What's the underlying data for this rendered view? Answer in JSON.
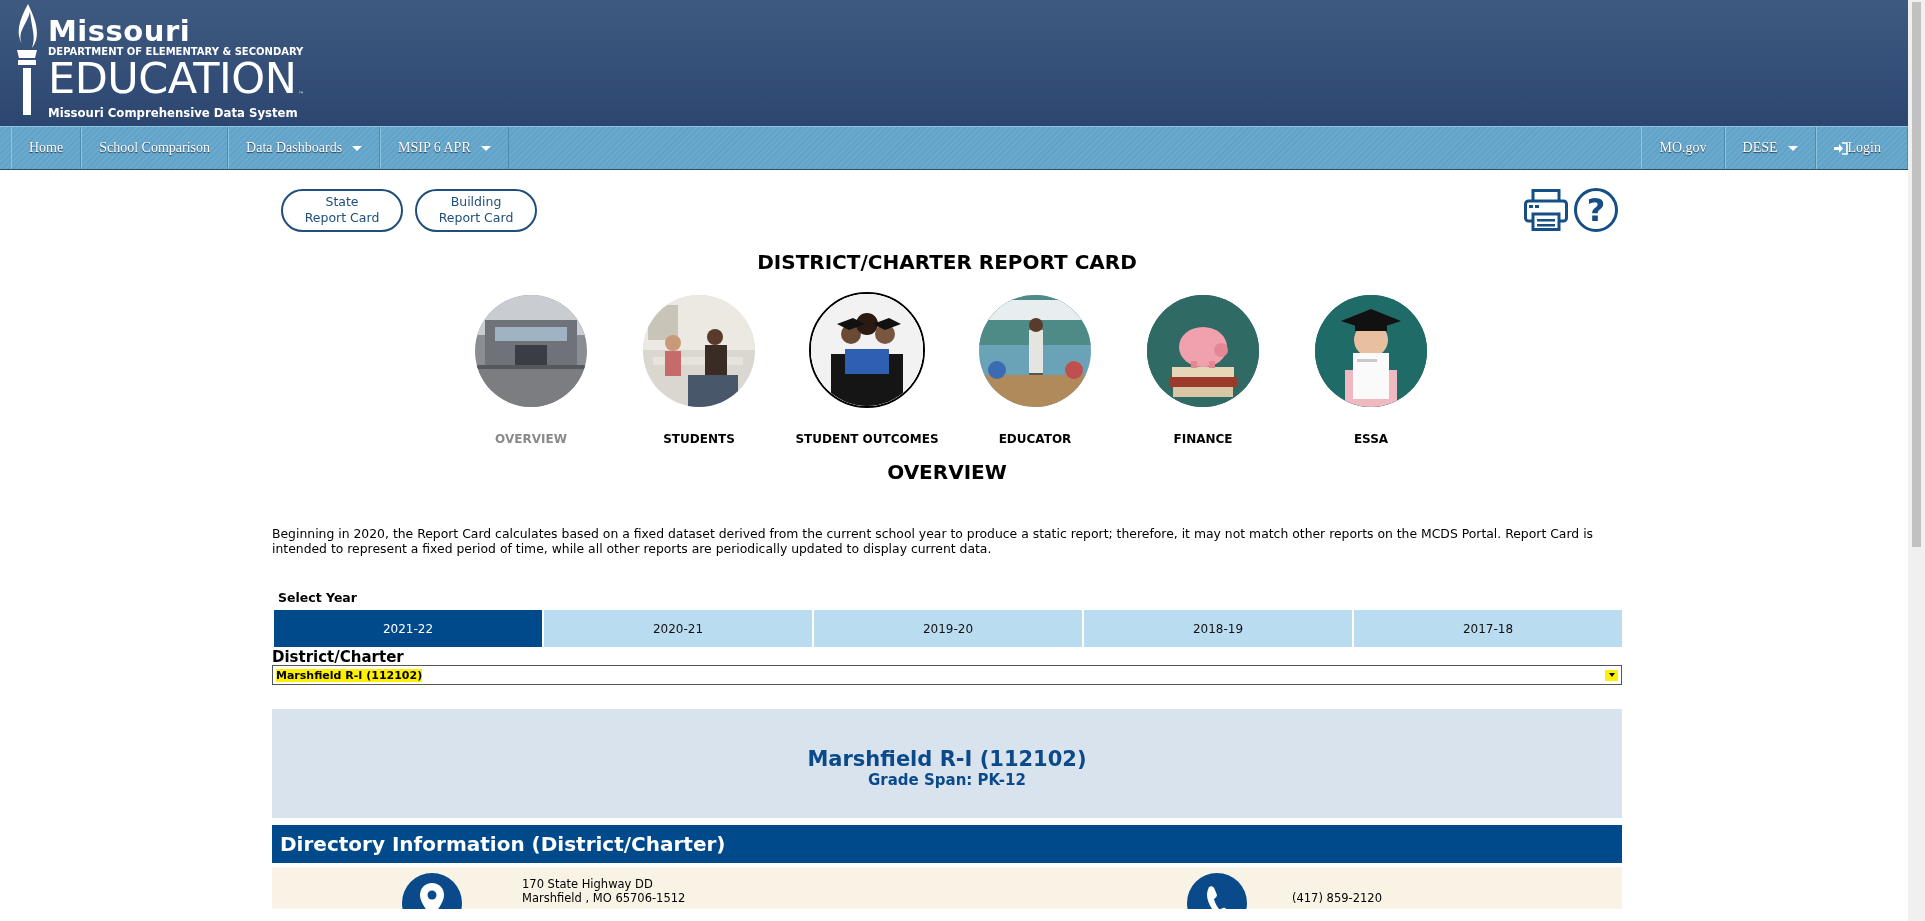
{
  "header": {
    "logo": {
      "title": "Missouri",
      "subtitle": "DEPARTMENT OF ELEMENTARY & SECONDARY",
      "name": "EDUCATION",
      "trademark": "™",
      "tagline": "Missouri Comprehensive Data System"
    }
  },
  "nav": {
    "left": [
      {
        "label": "Home",
        "kind": "link"
      },
      {
        "label": "School Comparison",
        "kind": "link"
      },
      {
        "label": "Data Dashboards",
        "kind": "dropdown"
      },
      {
        "label": "MSIP 6 APR",
        "kind": "dropdown"
      }
    ],
    "right": [
      {
        "label": "MO.gov",
        "kind": "link"
      },
      {
        "label": "DESE",
        "kind": "dropdown"
      },
      {
        "label": "Login",
        "kind": "login"
      }
    ]
  },
  "report_links": [
    {
      "lines": [
        "State",
        "Report Card"
      ]
    },
    {
      "lines": [
        "Building",
        "Report Card"
      ]
    }
  ],
  "tools": {
    "help_symbol": "?"
  },
  "title": "DISTRICT/CHARTER REPORT CARD",
  "categories": [
    {
      "label": "OVERVIEW",
      "selected": true,
      "outlined": false
    },
    {
      "label": "STUDENTS",
      "selected": false,
      "outlined": false
    },
    {
      "label": "STUDENT OUTCOMES",
      "selected": false,
      "outlined": true
    },
    {
      "label": "EDUCATOR",
      "selected": false,
      "outlined": false
    },
    {
      "label": "FINANCE",
      "selected": false,
      "outlined": false
    },
    {
      "label": "ESSA",
      "selected": false,
      "outlined": false
    }
  ],
  "section_title": "OVERVIEW",
  "notice": "Beginning in 2020, the Report Card calculates based on a fixed dataset derived from the current school year to produce a static report; therefore, it may not match other reports on the MCDS Portal. Report Card is intended to represent a fixed period of time, while all other reports are periodically updated to display current data.",
  "year_selector": {
    "label": "Select Year",
    "years": [
      {
        "label": "2021-22",
        "selected": true
      },
      {
        "label": "2020-21",
        "selected": false
      },
      {
        "label": "2019-20",
        "selected": false
      },
      {
        "label": "2018-19",
        "selected": false
      },
      {
        "label": "2017-18",
        "selected": false
      }
    ]
  },
  "district_select": {
    "label": "District/Charter",
    "value": "Marshfield R-I (112102)"
  },
  "district": {
    "name": "Marshfield R-I (112102)",
    "grade_span": "Grade Span: PK-12"
  },
  "directory": {
    "title": "Directory Information (District/Charter)",
    "address": [
      "170 State Highway DD",
      "Marshfield , MO 65706-1512"
    ],
    "phone": "(417) 859-2120"
  }
}
